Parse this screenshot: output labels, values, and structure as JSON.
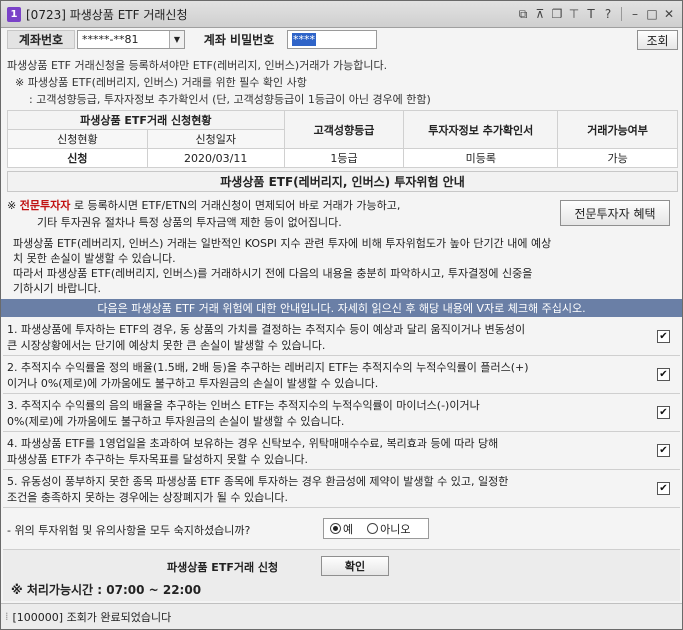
{
  "window": {
    "badge": "1",
    "title": "[0723] 파생상품 ETF 거래신청",
    "icons": [
      "link-icon",
      "pin-icon",
      "clone-icon",
      "thumbtack-icon",
      "font-size-icon",
      "help-icon",
      "minimize-icon",
      "maximize-icon",
      "close-icon"
    ]
  },
  "account": {
    "label": "계좌번호",
    "value": "*****-**81",
    "password_label": "계좌 비밀번호",
    "password_value": "****",
    "query_button": "조회"
  },
  "notice": {
    "line1": "파생상품 ETF 거래신청을 등록하셔야만 ETF(레버리지, 인버스)거래가 가능합니다.",
    "line2": "※ 파생상품 ETF(레버리지, 인버스) 거래를 위한 필수 확인 사항",
    "line3": ": 고객성향등급, 투자자정보 추가확인서 (단, 고객성향등급이 1등급이 아닌 경우에 한함)"
  },
  "status_table": {
    "group_header": "파생상품 ETF거래 신청현황",
    "col_status": "신청현황",
    "col_date": "신청일자",
    "col_grade": "고객성향등급",
    "col_investor": "투자자정보 추가확인서",
    "col_tradable": "거래가능여부",
    "row": {
      "status": "신청",
      "date": "2020/03/11",
      "grade": "1등급",
      "investor": "미등록",
      "tradable": "가능"
    }
  },
  "risk_section_title": "파생상품 ETF(레버리지, 인버스) 투자위험 안내",
  "pro_investor": {
    "mark": "※",
    "highlight": "전문투자자",
    "line1_rest": "로 등록하시면 ETF/ETN의 거래신청이 면제되어 바로 거래가 가능하고,",
    "line2": "기타 투자권유 절차나 특정 상품의 투자금액 제한 등이 없어집니다.",
    "benefit_button": "전문투자자 혜택",
    "para1_line1": "파생상품 ETF(레버리지, 인버스) 거래는 일반적인 KOSPI 지수 관련 투자에 비해 투자위험도가 높아 단기간 내에 예상",
    "para1_line2": "치 못한 손실이 발생할 수 있습니다.",
    "para2_line1": "따라서 파생상품 ETF(레버리지, 인버스)를 거래하시기 전에 다음의 내용을 충분히 파악하시고, 투자결정에 신중을",
    "para2_line2": "기하시기 바랍니다."
  },
  "banner": "다음은 파생상품 ETF 거래 위험에 대한 안내입니다. 자세히 읽으신 후 해당 내용에 V자로 체크해 주십시오.",
  "risk_items": [
    {
      "line1": "1. 파생상품에 투자하는 ETF의 경우, 동 상품의 가치를 결정하는 추적지수 등이 예상과 달리 움직이거나 변동성이",
      "line2": "   큰 시장상황에서는 단기에 예상치 못한 큰 손실이 발생할 수 있습니다.",
      "checked": "✔"
    },
    {
      "line1": "2. 추적지수 수익률을 정의 배율(1.5배, 2배 등)을 추구하는 레버리지 ETF는 추적지수의 누적수익률이 플러스(+)",
      "line2": "   이거나 0%(제로)에 가까움에도 불구하고 투자원금의 손실이 발생할 수 있습니다.",
      "checked": "✔"
    },
    {
      "line1": "3. 추적지수 수익률의 음의 배율을 추구하는 인버스 ETF는 추적지수의 누적수익률이 마이너스(-)이거나",
      "line2": "   0%(제로)에 가까움에도 불구하고 투자원금의 손실이 발생할 수 있습니다.",
      "checked": "✔"
    },
    {
      "line1": "4. 파생상품 ETF를 1영업일을 초과하여 보유하는 경우 신탁보수, 위탁매매수수료, 복리효과 등에 따라 당해",
      "line2": "   파생상품 ETF가 추구하는 투자목표를 달성하지 못할 수 있습니다.",
      "checked": "✔"
    },
    {
      "line1": "5. 유동성이 풍부하지 못한 종목 파생상품 ETF 종목에 투자하는 경우 환금성에 제약이 발생할 수 있고, 일정한",
      "line2": "   조건을 충족하지 못하는 경우에는 상장폐지가 될 수 있습니다.",
      "checked": "✔"
    }
  ],
  "confirm": {
    "question": "- 위의 투자위험 및 유의사항을 모두 숙지하셨습니까?",
    "yes": "예",
    "no": "아니오"
  },
  "apply": {
    "label": "파생상품 ETF거래 신청",
    "button": "확인",
    "hours": "※ 처리가능시간 : 07:00 ~ 22:00"
  },
  "statusbar": {
    "message": "[100000] 조회가 완료되었습니다"
  }
}
